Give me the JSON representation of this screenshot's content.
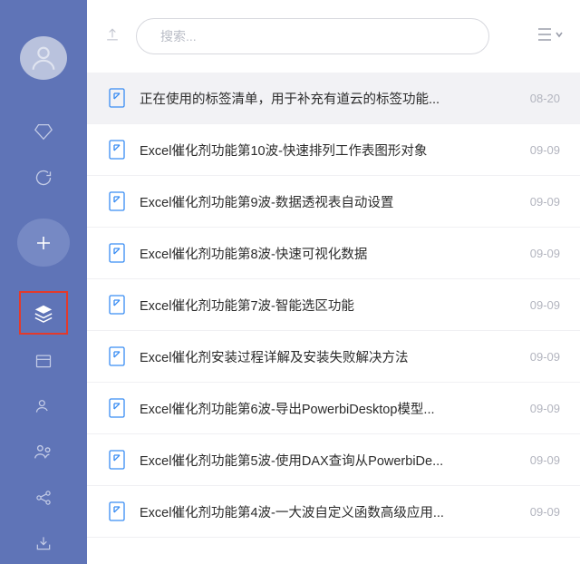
{
  "search": {
    "placeholder": "搜索..."
  },
  "items": [
    {
      "title": "正在使用的标签清单，用于补充有道云的标签功能...",
      "date": "08-20",
      "selected": true
    },
    {
      "title": "Excel催化剂功能第10波-快速排列工作表图形对象",
      "date": "09-09",
      "selected": false
    },
    {
      "title": "Excel催化剂功能第9波-数据透视表自动设置",
      "date": "09-09",
      "selected": false
    },
    {
      "title": "Excel催化剂功能第8波-快速可视化数据",
      "date": "09-09",
      "selected": false
    },
    {
      "title": "Excel催化剂功能第7波-智能选区功能",
      "date": "09-09",
      "selected": false
    },
    {
      "title": "Excel催化剂安装过程详解及安装失败解决方法",
      "date": "09-09",
      "selected": false
    },
    {
      "title": "Excel催化剂功能第6波-导出PowerbiDesktop模型...",
      "date": "09-09",
      "selected": false
    },
    {
      "title": "Excel催化剂功能第5波-使用DAX查询从PowerbiDe...",
      "date": "09-09",
      "selected": false
    },
    {
      "title": "Excel催化剂功能第4波-一大波自定义函数高级应用...",
      "date": "09-09",
      "selected": false
    }
  ],
  "colors": {
    "sidebar": "#5f74b7",
    "highlight": "#e33a2b",
    "iconBlue": "#398df3"
  }
}
